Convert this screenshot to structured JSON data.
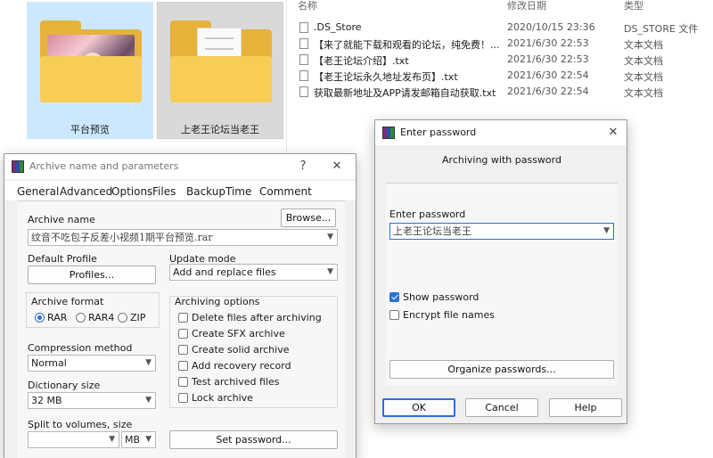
{
  "explorer": {
    "thumbnails": [
      {
        "caption": "平台预览",
        "icon": "folder-with-photo-icon"
      },
      {
        "caption": "上老王论坛当老王",
        "icon": "folder-with-document-icon"
      }
    ],
    "columns": {
      "name": "名称",
      "date": "修改日期",
      "type": "类型"
    },
    "files": [
      {
        "name": ".DS_Store",
        "date": "2020/10/15 23:36",
        "type": "DS_STORE 文件"
      },
      {
        "name": "【来了就能下载和观看的论坛，纯免费！...",
        "date": "2021/6/30 22:53",
        "type": "文本文档"
      },
      {
        "name": "【老王论坛介绍】.txt",
        "date": "2021/6/30 22:53",
        "type": "文本文档"
      },
      {
        "name": "【老王论坛永久地址发布页】.txt",
        "date": "2021/6/30 22:54",
        "type": "文本文档"
      },
      {
        "name": "获取最新地址及APP请发邮箱自动获取.txt",
        "date": "2021/6/30 22:54",
        "type": "文本文档"
      }
    ]
  },
  "archive_dialog": {
    "title": "Archive name and parameters",
    "help": "?",
    "close": "✕",
    "tabs": [
      "General",
      "Advanced",
      "Options",
      "Files",
      "Backup",
      "Time",
      "Comment"
    ],
    "archive_name_label": "Archive name",
    "browse_label": "Browse...",
    "archive_name_value": "纹音不吃包子反差小视频1期平台预览.rar",
    "default_profile_label": "Default Profile",
    "profiles_label": "Profiles...",
    "update_mode_label": "Update mode",
    "update_mode_value": "Add and replace files",
    "archive_format_label": "Archive format",
    "formats": [
      {
        "label": "RAR",
        "selected": true
      },
      {
        "label": "RAR4",
        "selected": false
      },
      {
        "label": "ZIP",
        "selected": false
      }
    ],
    "archiving_options_label": "Archiving options",
    "options": [
      {
        "label": "Delete files after archiving",
        "checked": false
      },
      {
        "label": "Create SFX archive",
        "checked": false
      },
      {
        "label": "Create solid archive",
        "checked": false
      },
      {
        "label": "Add recovery record",
        "checked": false
      },
      {
        "label": "Test archived files",
        "checked": false
      },
      {
        "label": "Lock archive",
        "checked": false
      }
    ],
    "compression_label": "Compression method",
    "compression_value": "Normal",
    "dictionary_label": "Dictionary size",
    "dictionary_value": "32 MB",
    "split_label": "Split to volumes, size",
    "split_value": "",
    "split_unit": "MB",
    "set_password_label": "Set password..."
  },
  "password_dialog": {
    "title": "Enter password",
    "close": "✕",
    "subtitle": "Archiving with password",
    "enter_label": "Enter password",
    "password_value": "上老王论坛当老王",
    "show_password_label": "Show password",
    "show_password_checked": true,
    "encrypt_names_label": "Encrypt file names",
    "encrypt_names_checked": false,
    "organize_label": "Organize passwords...",
    "ok_label": "OK",
    "cancel_label": "Cancel",
    "help_label": "Help"
  },
  "colors": {
    "accent": "#2a6fdb",
    "selection": "#cce8ff",
    "folder": "#f7cd55"
  }
}
